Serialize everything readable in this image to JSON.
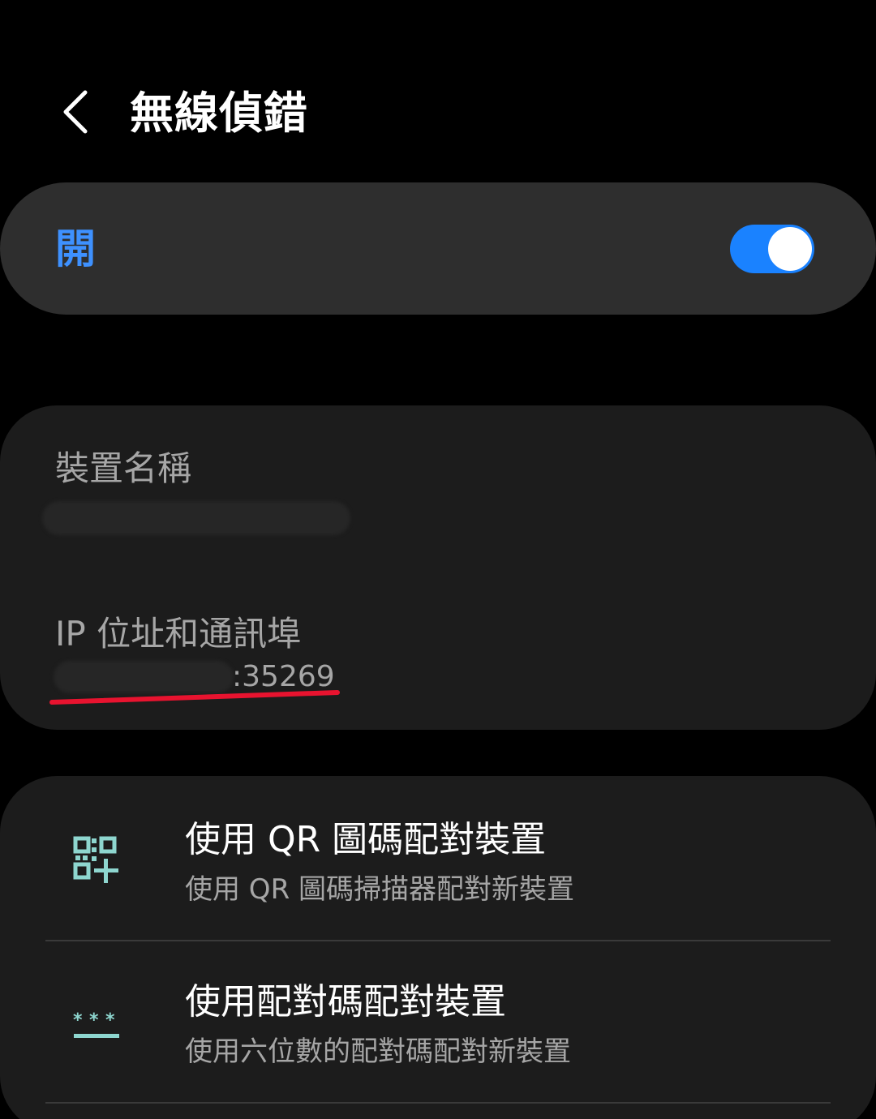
{
  "colors": {
    "background": "#000000",
    "card": "#1c1c1c",
    "toggle_card": "#2e2e2e",
    "accent_blue": "#3e91ff",
    "switch_on": "#1a82ff",
    "secondary_text": "#a6a6a6",
    "icon_teal": "#8ed6cf",
    "annotation_red": "#e8132f"
  },
  "header": {
    "title": "無線偵錯",
    "back_icon": "chevron-left-icon"
  },
  "master_toggle": {
    "label": "開",
    "state": "on"
  },
  "device_info": {
    "device_name_label": "裝置名稱",
    "ip_label": "IP 位址和通訊埠",
    "ip_port_suffix": ":35269"
  },
  "pairing": {
    "items": [
      {
        "title": "使用 QR 圖碼配對裝置",
        "subtitle": "使用 QR 圖碼掃描器配對新裝置",
        "icon": "qr-code-icon"
      },
      {
        "title": "使用配對碼配對裝置",
        "subtitle": "使用六位數的配對碼配對新裝置",
        "icon": "pairing-code-icon"
      }
    ]
  }
}
